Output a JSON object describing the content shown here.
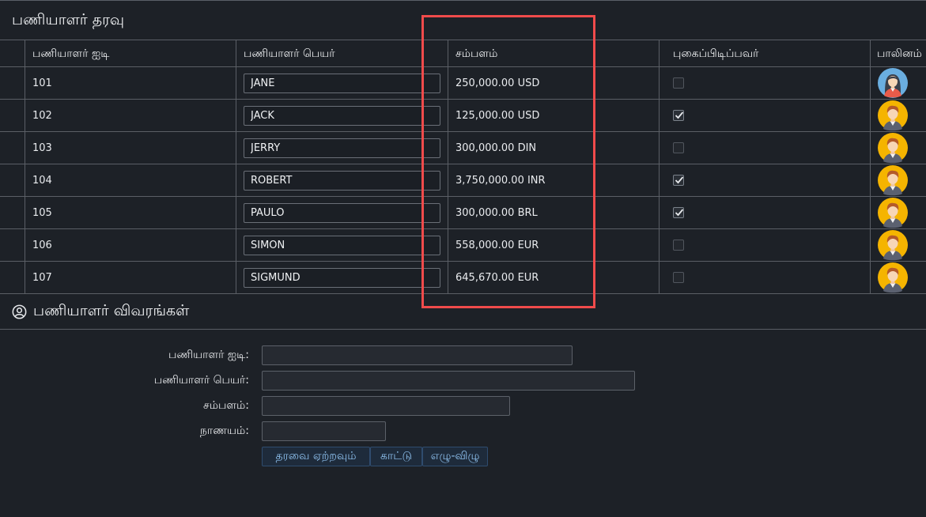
{
  "panel": {
    "title": "பணியாளர் தரவு"
  },
  "table": {
    "headers": {
      "id": "பணியாளர் ஐடி",
      "name": "பணியாளர் பெயர்",
      "salary": "சம்பளம்",
      "smoker": "புகைப்பிடிப்பவர்",
      "gender": "பாலினம்"
    },
    "rows": [
      {
        "id": "101",
        "name": "JANE",
        "salary": "250,000.00 USD",
        "smoker": false,
        "avatar": "female-avatar-icon"
      },
      {
        "id": "102",
        "name": "JACK",
        "salary": "125,000.00 USD",
        "smoker": true,
        "avatar": "male-avatar-icon"
      },
      {
        "id": "103",
        "name": "JERRY",
        "salary": "300,000.00 DIN",
        "smoker": false,
        "avatar": "male-avatar-icon"
      },
      {
        "id": "104",
        "name": "ROBERT",
        "salary": "3,750,000.00 INR",
        "smoker": true,
        "avatar": "male-avatar-icon"
      },
      {
        "id": "105",
        "name": "PAULO",
        "salary": "300,000.00 BRL",
        "smoker": true,
        "avatar": "male-avatar-icon"
      },
      {
        "id": "106",
        "name": "SIMON",
        "salary": "558,000.00 EUR",
        "smoker": false,
        "avatar": "male-avatar-icon"
      },
      {
        "id": "107",
        "name": "SIGMUND",
        "salary": "645,670.00 EUR",
        "smoker": false,
        "avatar": "male-avatar-icon"
      }
    ]
  },
  "details": {
    "title": "பணியாளர் விவரங்கள்",
    "icon": "user-circle-icon",
    "labels": {
      "id": "பணியாளர் ஐடி:",
      "name": "பணியாளர் பெயர்:",
      "salary": "சம்பளம்:",
      "currency": "நாணயம்:"
    },
    "values": {
      "id": "",
      "name": "",
      "salary": "",
      "currency": ""
    }
  },
  "buttons": {
    "load": "தரவை ஏற்றவும்",
    "show": "காட்டு",
    "toggle": "எழு-விழு"
  },
  "colors": {
    "background": "#1d2127",
    "highlight": "#f04b4b",
    "button_text": "#8fc2f0",
    "female_avatar_bg": "#6aaee0",
    "male_avatar_bg": "#f5b400"
  }
}
